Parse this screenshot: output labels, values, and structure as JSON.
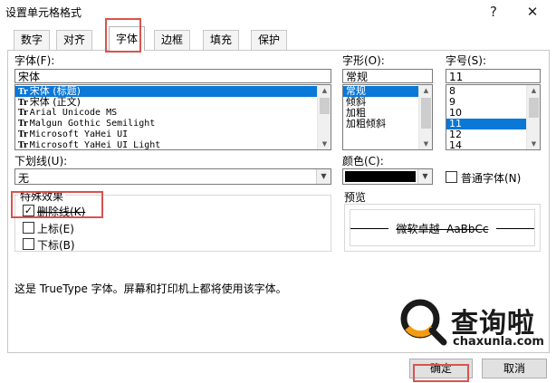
{
  "window": {
    "title": "设置单元格格式",
    "help_label": "?",
    "close_label": "✕"
  },
  "tabs": [
    {
      "label": "数字"
    },
    {
      "label": "对齐"
    },
    {
      "label": "字体"
    },
    {
      "label": "边框"
    },
    {
      "label": "填充"
    },
    {
      "label": "保护"
    }
  ],
  "font": {
    "label": "字体(F):",
    "value": "宋体",
    "items": [
      {
        "icon": "Tr",
        "label": "宋体 (标题)"
      },
      {
        "icon": "Tr",
        "label": "宋体 (正文)"
      },
      {
        "icon": "Tr",
        "label": "Arial Unicode MS"
      },
      {
        "icon": "Tr",
        "label": "Malgun Gothic Semilight"
      },
      {
        "icon": "Tr",
        "label": "Microsoft YaHei UI"
      },
      {
        "icon": "Tr",
        "label": "Microsoft YaHei UI Light"
      }
    ]
  },
  "style": {
    "label": "字形(O):",
    "value": "常规",
    "items": [
      "常规",
      "倾斜",
      "加粗",
      "加粗倾斜"
    ]
  },
  "size": {
    "label": "字号(S):",
    "value": "11",
    "items": [
      "8",
      "9",
      "10",
      "11",
      "12",
      "14"
    ]
  },
  "underline": {
    "label": "下划线(U):",
    "value": "无"
  },
  "color": {
    "label": "颜色(C):",
    "swatch_color": "#000000",
    "normal_font_label": "普通字体(N)"
  },
  "effects": {
    "label": "特殊效果",
    "strikethrough_label": "删除线(K)",
    "superscript_label": "上标(E)",
    "subscript_label": "下标(B)"
  },
  "preview": {
    "label": "预览",
    "sample_text": "微软卓越  AaBbCc"
  },
  "info_text": "这是 TrueType 字体。屏幕和打印机上都将使用该字体。",
  "buttons": {
    "ok_label": "确定",
    "cancel_label": "取消"
  },
  "watermark": {
    "brand_text": "查询啦",
    "domain_text": "chaxunla.com"
  },
  "colors": {
    "selection": "#0a78d7",
    "highlight": "#d9534f",
    "watermark": "#1a1a1a",
    "logo_orange": "#f39c12"
  },
  "icons": {
    "font_type": "truetype-icon",
    "logo": "magnifier-logo-icon"
  }
}
